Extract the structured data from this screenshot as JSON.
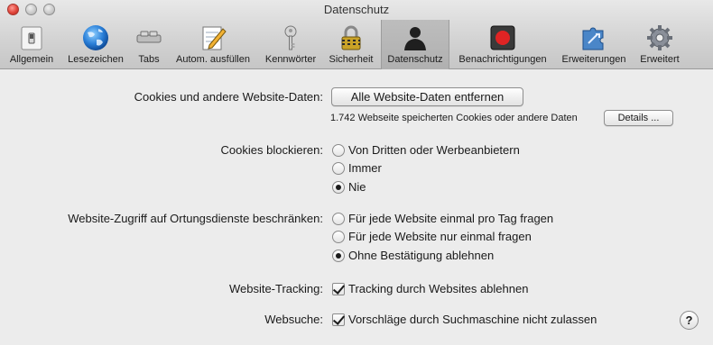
{
  "window": {
    "title": "Datenschutz"
  },
  "toolbar": {
    "tabs": [
      {
        "label": "Allgemein",
        "icon": "switch-icon"
      },
      {
        "label": "Lesezeichen",
        "icon": "globe-icon"
      },
      {
        "label": "Tabs",
        "icon": "tabs-icon"
      },
      {
        "label": "Autom. ausfüllen",
        "icon": "pencil-notepad-icon"
      },
      {
        "label": "Kennwörter",
        "icon": "key-icon"
      },
      {
        "label": "Sicherheit",
        "icon": "padlock-icon"
      },
      {
        "label": "Datenschutz",
        "icon": "silhouette-icon"
      },
      {
        "label": "Benachrichtigungen",
        "icon": "notification-icon"
      },
      {
        "label": "Erweiterungen",
        "icon": "puzzle-icon"
      },
      {
        "label": "Erweitert",
        "icon": "gear-icon"
      }
    ],
    "active_tab": "Datenschutz"
  },
  "cookies": {
    "label": "Cookies und andere Website-Daten:",
    "remove_button": "Alle Website-Daten entfernen",
    "info": "1.742 Webseite speicherten Cookies oder andere Daten",
    "details_button": "Details ..."
  },
  "block_cookies": {
    "label": "Cookies blockieren:",
    "options": [
      "Von Dritten oder Werbeanbietern",
      "Immer",
      "Nie"
    ],
    "selected": "Nie"
  },
  "location": {
    "label": "Website-Zugriff auf Ortungsdienste beschränken:",
    "options": [
      "Für jede Website einmal pro Tag fragen",
      "Für jede Website nur einmal fragen",
      "Ohne Bestätigung ablehnen"
    ],
    "selected": "Ohne Bestätigung ablehnen"
  },
  "tracking": {
    "label": "Website-Tracking:",
    "checkbox_label": "Tracking durch Websites ablehnen",
    "checked": true
  },
  "search": {
    "label": "Websuche:",
    "checkbox_label": "Vorschläge durch Suchmaschine nicht zulassen",
    "checked": true
  },
  "help": {
    "label": "?"
  }
}
